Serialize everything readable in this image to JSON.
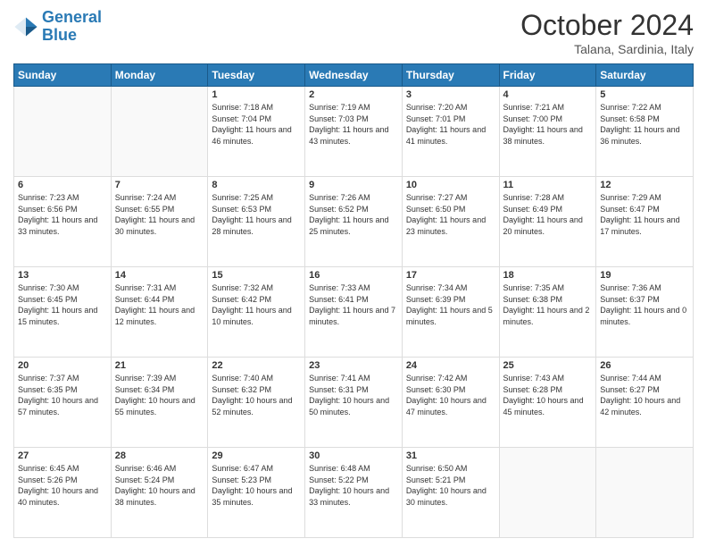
{
  "header": {
    "logo_general": "General",
    "logo_blue": "Blue",
    "month_title": "October 2024",
    "location": "Talana, Sardinia, Italy"
  },
  "days_of_week": [
    "Sunday",
    "Monday",
    "Tuesday",
    "Wednesday",
    "Thursday",
    "Friday",
    "Saturday"
  ],
  "weeks": [
    [
      {
        "day": "",
        "content": ""
      },
      {
        "day": "",
        "content": ""
      },
      {
        "day": "1",
        "content": "Sunrise: 7:18 AM\nSunset: 7:04 PM\nDaylight: 11 hours and 46 minutes."
      },
      {
        "day": "2",
        "content": "Sunrise: 7:19 AM\nSunset: 7:03 PM\nDaylight: 11 hours and 43 minutes."
      },
      {
        "day": "3",
        "content": "Sunrise: 7:20 AM\nSunset: 7:01 PM\nDaylight: 11 hours and 41 minutes."
      },
      {
        "day": "4",
        "content": "Sunrise: 7:21 AM\nSunset: 7:00 PM\nDaylight: 11 hours and 38 minutes."
      },
      {
        "day": "5",
        "content": "Sunrise: 7:22 AM\nSunset: 6:58 PM\nDaylight: 11 hours and 36 minutes."
      }
    ],
    [
      {
        "day": "6",
        "content": "Sunrise: 7:23 AM\nSunset: 6:56 PM\nDaylight: 11 hours and 33 minutes."
      },
      {
        "day": "7",
        "content": "Sunrise: 7:24 AM\nSunset: 6:55 PM\nDaylight: 11 hours and 30 minutes."
      },
      {
        "day": "8",
        "content": "Sunrise: 7:25 AM\nSunset: 6:53 PM\nDaylight: 11 hours and 28 minutes."
      },
      {
        "day": "9",
        "content": "Sunrise: 7:26 AM\nSunset: 6:52 PM\nDaylight: 11 hours and 25 minutes."
      },
      {
        "day": "10",
        "content": "Sunrise: 7:27 AM\nSunset: 6:50 PM\nDaylight: 11 hours and 23 minutes."
      },
      {
        "day": "11",
        "content": "Sunrise: 7:28 AM\nSunset: 6:49 PM\nDaylight: 11 hours and 20 minutes."
      },
      {
        "day": "12",
        "content": "Sunrise: 7:29 AM\nSunset: 6:47 PM\nDaylight: 11 hours and 17 minutes."
      }
    ],
    [
      {
        "day": "13",
        "content": "Sunrise: 7:30 AM\nSunset: 6:45 PM\nDaylight: 11 hours and 15 minutes."
      },
      {
        "day": "14",
        "content": "Sunrise: 7:31 AM\nSunset: 6:44 PM\nDaylight: 11 hours and 12 minutes."
      },
      {
        "day": "15",
        "content": "Sunrise: 7:32 AM\nSunset: 6:42 PM\nDaylight: 11 hours and 10 minutes."
      },
      {
        "day": "16",
        "content": "Sunrise: 7:33 AM\nSunset: 6:41 PM\nDaylight: 11 hours and 7 minutes."
      },
      {
        "day": "17",
        "content": "Sunrise: 7:34 AM\nSunset: 6:39 PM\nDaylight: 11 hours and 5 minutes."
      },
      {
        "day": "18",
        "content": "Sunrise: 7:35 AM\nSunset: 6:38 PM\nDaylight: 11 hours and 2 minutes."
      },
      {
        "day": "19",
        "content": "Sunrise: 7:36 AM\nSunset: 6:37 PM\nDaylight: 11 hours and 0 minutes."
      }
    ],
    [
      {
        "day": "20",
        "content": "Sunrise: 7:37 AM\nSunset: 6:35 PM\nDaylight: 10 hours and 57 minutes."
      },
      {
        "day": "21",
        "content": "Sunrise: 7:39 AM\nSunset: 6:34 PM\nDaylight: 10 hours and 55 minutes."
      },
      {
        "day": "22",
        "content": "Sunrise: 7:40 AM\nSunset: 6:32 PM\nDaylight: 10 hours and 52 minutes."
      },
      {
        "day": "23",
        "content": "Sunrise: 7:41 AM\nSunset: 6:31 PM\nDaylight: 10 hours and 50 minutes."
      },
      {
        "day": "24",
        "content": "Sunrise: 7:42 AM\nSunset: 6:30 PM\nDaylight: 10 hours and 47 minutes."
      },
      {
        "day": "25",
        "content": "Sunrise: 7:43 AM\nSunset: 6:28 PM\nDaylight: 10 hours and 45 minutes."
      },
      {
        "day": "26",
        "content": "Sunrise: 7:44 AM\nSunset: 6:27 PM\nDaylight: 10 hours and 42 minutes."
      }
    ],
    [
      {
        "day": "27",
        "content": "Sunrise: 6:45 AM\nSunset: 5:26 PM\nDaylight: 10 hours and 40 minutes."
      },
      {
        "day": "28",
        "content": "Sunrise: 6:46 AM\nSunset: 5:24 PM\nDaylight: 10 hours and 38 minutes."
      },
      {
        "day": "29",
        "content": "Sunrise: 6:47 AM\nSunset: 5:23 PM\nDaylight: 10 hours and 35 minutes."
      },
      {
        "day": "30",
        "content": "Sunrise: 6:48 AM\nSunset: 5:22 PM\nDaylight: 10 hours and 33 minutes."
      },
      {
        "day": "31",
        "content": "Sunrise: 6:50 AM\nSunset: 5:21 PM\nDaylight: 10 hours and 30 minutes."
      },
      {
        "day": "",
        "content": ""
      },
      {
        "day": "",
        "content": ""
      }
    ]
  ]
}
